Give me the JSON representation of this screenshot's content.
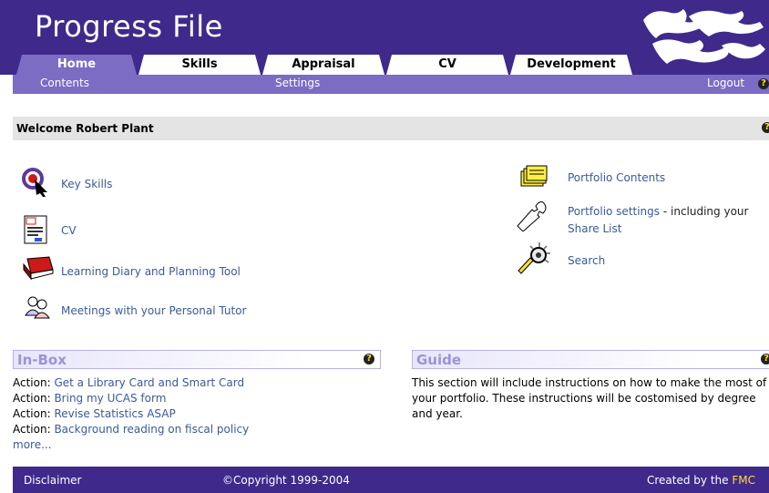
{
  "header": {
    "title": "Progress File"
  },
  "tabs": [
    {
      "label": "Home",
      "active": true
    },
    {
      "label": "Skills",
      "active": false
    },
    {
      "label": "Appraisal",
      "active": false
    },
    {
      "label": "CV",
      "active": false
    },
    {
      "label": "Development",
      "active": false
    }
  ],
  "subnav": {
    "contents": "Contents",
    "settings": "Settings",
    "logout": "Logout"
  },
  "welcome": {
    "text": "Welcome Robert Plant"
  },
  "left_links": [
    {
      "label": "Key Skills",
      "icon": "target-cursor-icon"
    },
    {
      "label": "CV",
      "icon": "cv-document-icon"
    },
    {
      "label": "Learning Diary and Planning Tool",
      "icon": "red-book-icon"
    },
    {
      "label": "Meetings with your Personal Tutor",
      "icon": "people-icon"
    }
  ],
  "right_links": {
    "portfolio_contents": "Portfolio Contents",
    "portfolio_settings": "Portfolio settings",
    "settings_suffix": " - including your",
    "share_list": "Share List",
    "search": "Search"
  },
  "inbox": {
    "title": "In-Box",
    "prefix": "Action: ",
    "actions": [
      "Get a Library Card and Smart Card",
      "Bring my UCAS form",
      "Revise Statistics ASAP",
      "Background reading on fiscal policy"
    ],
    "more": "more..."
  },
  "guide": {
    "title": "Guide",
    "text": "This section will include instructions on how to make the most of your portfolio. These instructions will be costomised by degree and year."
  },
  "footer": {
    "disclaimer": "Disclaimer",
    "copyright": "©Copyright 1999-2004",
    "created": "Created by the ",
    "fmc": "FMC"
  },
  "colors": {
    "header": "#3f2a8c",
    "subnav": "#7c6cc4",
    "link": "#3a5a9a",
    "fmc": "#ffdd33"
  },
  "help_glyph": "?"
}
